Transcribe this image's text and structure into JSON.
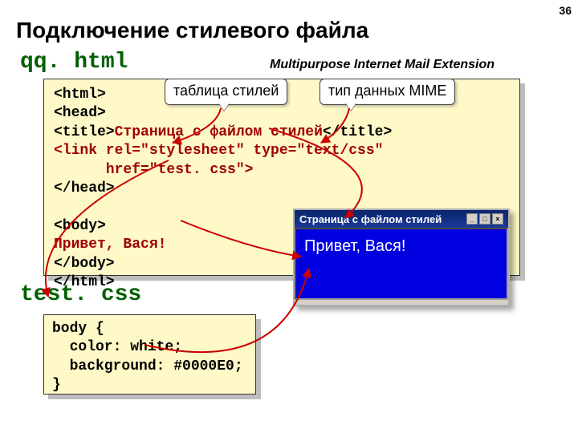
{
  "page_number": "36",
  "title": "Подключение стилевого файла",
  "file1_name": "qq. html",
  "mime_note": "Multipurpose Internet Mail Extension",
  "callout_stylesheet": "таблица стилей",
  "callout_mime": "тип данных MIME",
  "code1": {
    "l1": "<html>",
    "l2": "<head>",
    "l3a": "<title>",
    "l3b": "Страница с файлом стилей",
    "l3c": "</title>",
    "l4": "<link rel=\"stylesheet\" type=\"text/css\"",
    "l5": "      href=\"test. css\">",
    "l6": "</head>",
    "l7": "<body>",
    "l8": "Привет, Вася!",
    "l9": "</body>",
    "l10": "</html>"
  },
  "file2_name": "test. css",
  "code2": {
    "l1": "body {",
    "l2": "  color: white;",
    "l3": "  background: #0000E0;",
    "l4": "}"
  },
  "window": {
    "title": "Страница с файлом стилей",
    "body": "Привет, Вася!",
    "btn_min": "_",
    "btn_max": "□",
    "btn_close": "×"
  }
}
